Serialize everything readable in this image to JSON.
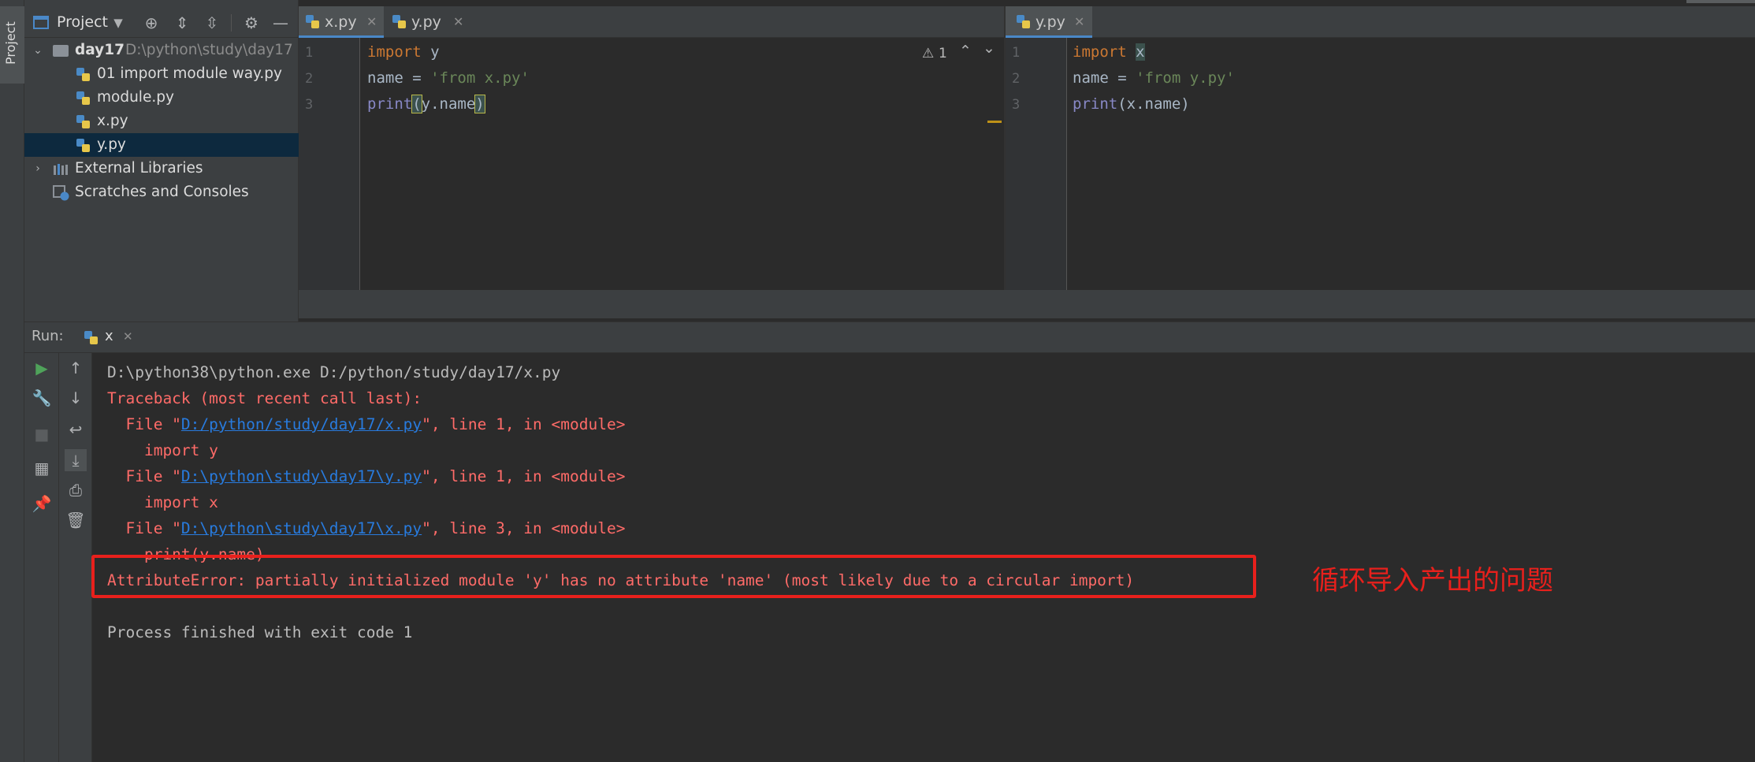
{
  "sidebar": {
    "vertical_tab": "Project"
  },
  "project_panel": {
    "title": "Project",
    "tree": [
      {
        "label": "day17",
        "path": "D:\\python\\study\\day17"
      },
      {
        "label": "01 import module way.py"
      },
      {
        "label": "module.py"
      },
      {
        "label": "x.py"
      },
      {
        "label": "y.py"
      },
      {
        "label": "External Libraries"
      },
      {
        "label": "Scratches and Consoles"
      }
    ]
  },
  "editor_left": {
    "tabs": [
      {
        "label": "x.py",
        "active": true
      },
      {
        "label": "y.py",
        "active": false
      }
    ],
    "warning_count": "1",
    "line_numbers": [
      "1",
      "2",
      "3"
    ],
    "lines": {
      "l1_kw": "import",
      "l1_rest": " y",
      "l2_name": "name = ",
      "l2_str": "'from x.py'",
      "l3_fn": "print",
      "l3_open": "(",
      "l3_arg": "y.name",
      "l3_close": ")"
    }
  },
  "editor_right": {
    "tabs": [
      {
        "label": "y.py",
        "active": true
      }
    ],
    "line_numbers": [
      "1",
      "2",
      "3"
    ],
    "lines": {
      "l1_kw": "import",
      "l1_rest": "x",
      "l2_name": "name = ",
      "l2_str": "'from y.py'",
      "l3_fn": "print",
      "l3_open": "(",
      "l3_arg": "x.name",
      "l3_close": ")"
    }
  },
  "run": {
    "label": "Run:",
    "tab_label": "x",
    "console": {
      "cmd": "D:\\python38\\python.exe D:/python/study/day17/x.py",
      "traceback": "Traceback (most recent call last):",
      "f1_pre": "  File \"",
      "f1_link": "D:/python/study/day17/x.py",
      "f1_post": "\", line 1, in <module>",
      "f1_code": "    import y",
      "f2_pre": "  File \"",
      "f2_link": "D:\\python\\study\\day17\\y.py",
      "f2_post": "\", line 1, in <module>",
      "f2_code": "    import x",
      "f3_pre": "  File \"",
      "f3_link": "D:\\python\\study\\day17\\x.py",
      "f3_post": "\", line 3, in <module>",
      "f3_code": "    print(y.name)",
      "error": "AttributeError: partially initialized module 'y' has no attribute 'name' (most likely due to a circular import)",
      "exit": "Process finished with exit code 1"
    }
  },
  "annotation": {
    "text": "循环导入产出的问题",
    "color": "#e8201c"
  },
  "colors": {
    "link": "#287bde",
    "error_text": "#ff6b68",
    "keyword": "#cc7832",
    "string": "#6a8759"
  }
}
